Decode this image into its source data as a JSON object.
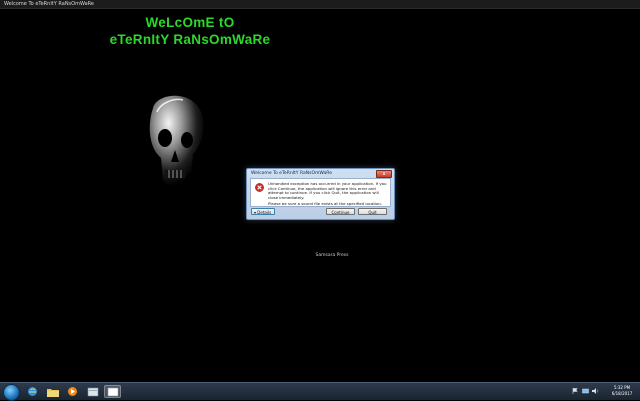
{
  "window": {
    "title": "Welcome To eTeRnItY RaNsOmWaRe"
  },
  "headline": {
    "line1": "WeLcOmE tO",
    "line2": "eTeRnItY RaNsOmWaRe"
  },
  "credit": "Samsara Press",
  "dialog": {
    "title": "Welcome To eTeRnItY RaNsOmWaRe",
    "message1": "Unhandled exception has occurred in your application. If you click Continue, the application will ignore this error and attempt to continue. If you click Quit, the application will close immediately.",
    "message2": "Please be sure a sound file exists at the specified location.",
    "details_label": "Details",
    "continue_label": "Continue",
    "quit_label": "Quit",
    "close_label": "x"
  },
  "taskbar": {
    "items": [
      "internet-explorer-icon",
      "folder-icon",
      "media-player-icon",
      "app-icon",
      "window-icon"
    ],
    "time": "5:32 PM",
    "date": "6/18/2017"
  },
  "colors": {
    "headline": "#2bd92b",
    "background": "#000000",
    "error": "#d12a1e"
  }
}
